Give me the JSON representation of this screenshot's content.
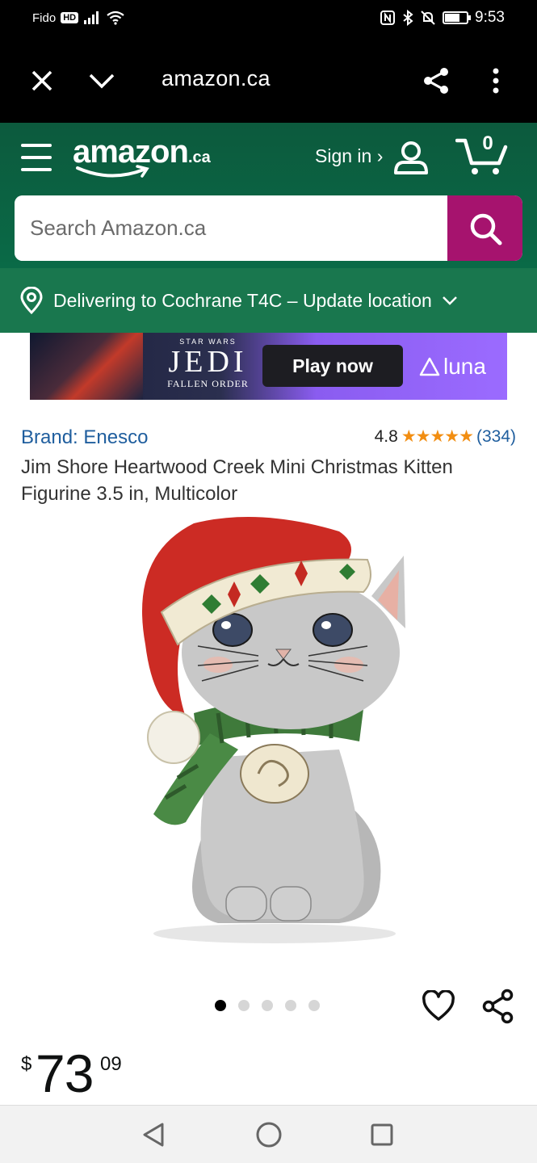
{
  "status_bar": {
    "carrier": "Fido",
    "hd_label": "HD",
    "time": "9:53",
    "battery_level": 0.7
  },
  "browser": {
    "url": "amazon.ca",
    "icons": [
      "close-icon",
      "chevron-down-icon",
      "share-icon",
      "more-vertical-icon"
    ]
  },
  "header": {
    "logo_word": "amazon",
    "logo_suffix": ".ca",
    "signin_label": "Sign in ›",
    "cart_count": "0",
    "search_placeholder": "Search Amazon.ca"
  },
  "location": {
    "text": "Delivering to Cochrane T4C – Update location"
  },
  "ad": {
    "small_top": "STAR WARS",
    "title": "JEDI",
    "subtitle": "FALLEN ORDER",
    "button_label": "Play now",
    "brand": "luna"
  },
  "product": {
    "brand": "Brand: Enesco",
    "rating_value": "4.8",
    "stars": "★★★★★",
    "rating_count": "(334)",
    "title": "Jim Shore Heartwood Creek Mini Christmas Kitten Figurine 3.5 in, Multicolor",
    "image_count": 5,
    "active_image": 1
  },
  "price": {
    "currency": "$",
    "whole": "73",
    "fraction": "09"
  },
  "colors": {
    "header_green": "#0c5a3d",
    "location_green": "#19774e",
    "search_button": "#a6136e",
    "link_blue": "#1f5e9e",
    "star_orange": "#f28e12"
  }
}
